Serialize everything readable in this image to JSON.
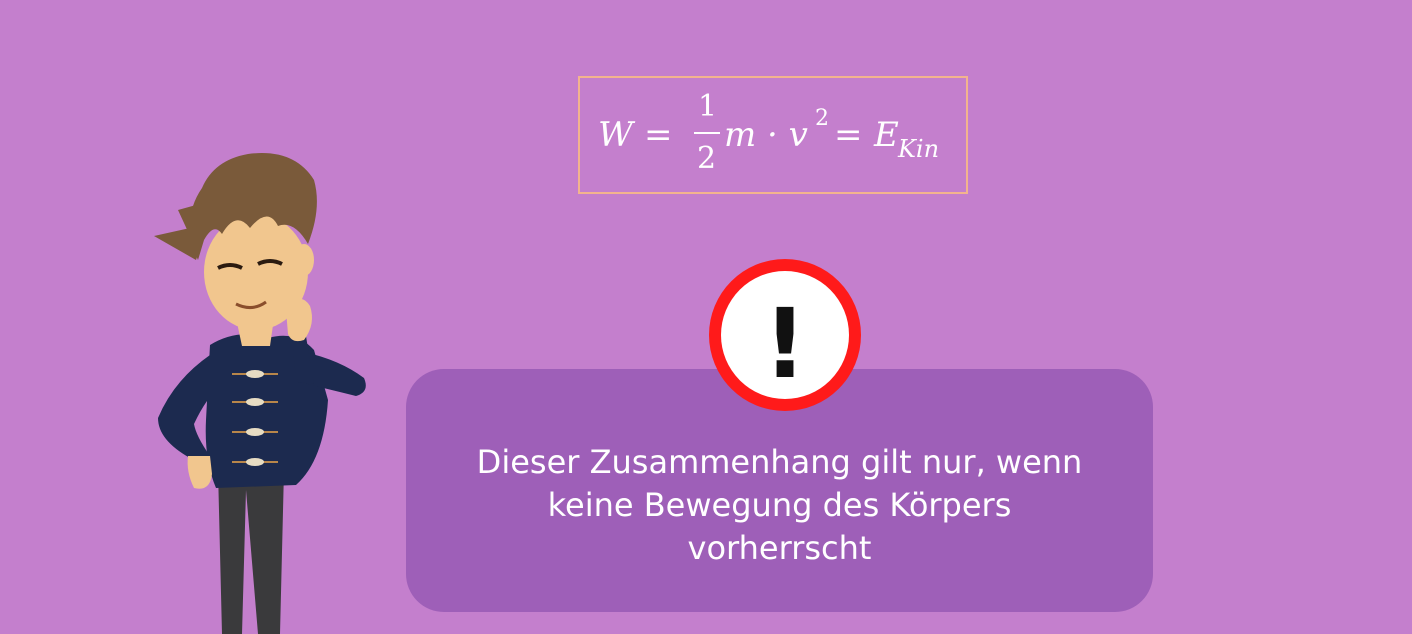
{
  "formula": {
    "w": "W",
    "eq1": "=",
    "num": "1",
    "den": "2",
    "m_dot_v": "m · v",
    "exp": "2",
    "eq2": "=",
    "e": "E",
    "sub": "Kin"
  },
  "alert": {
    "symbol": "!"
  },
  "note": {
    "line1": "Dieser Zusammenhang gilt nur, wenn",
    "line2": "keine Bewegung des Körpers",
    "line3": "vorherrscht"
  },
  "colors": {
    "background": "#c47fcd",
    "box": "#9e5fb8",
    "formula_border": "#f3b48e",
    "alert_ring": "#ff1a1a"
  }
}
